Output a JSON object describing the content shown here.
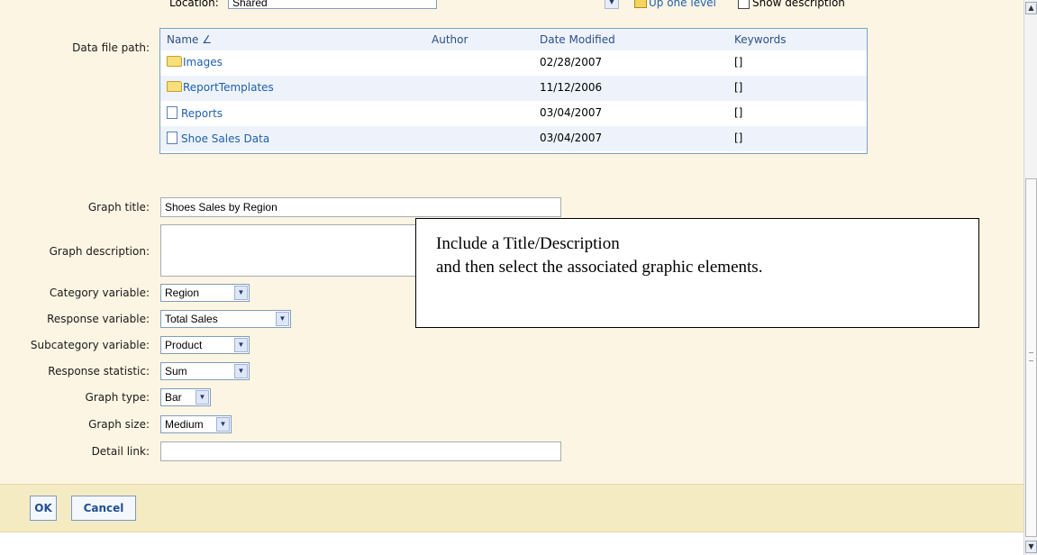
{
  "location": {
    "label": "Location:",
    "value": "Shared",
    "up_level": "Up one level",
    "show_description": "Show description"
  },
  "data_file_path_label": "Data file path:",
  "file_table": {
    "columns": {
      "name": "Name",
      "sort_indicator": "∠",
      "author": "Author",
      "date": "Date Modified",
      "keywords": "Keywords"
    },
    "rows": [
      {
        "name": "Images",
        "type": "folder",
        "date": "02/28/2007",
        "keywords": "[]"
      },
      {
        "name": "ReportTemplates",
        "type": "folder",
        "date": "11/12/2006",
        "keywords": "[]"
      },
      {
        "name": "Reports",
        "type": "document",
        "date": "03/04/2007",
        "keywords": "[]"
      },
      {
        "name": "Shoe Sales Data",
        "type": "document",
        "date": "03/04/2007",
        "keywords": "[]"
      }
    ]
  },
  "form": {
    "graph_title": {
      "label": "Graph title:",
      "value": "Shoes Sales by Region"
    },
    "graph_description": {
      "label": "Graph description:",
      "value": ""
    },
    "category_variable": {
      "label": "Category variable:",
      "value": "Region"
    },
    "response_variable": {
      "label": "Response variable:",
      "value": "Total Sales"
    },
    "subcategory_variable": {
      "label": "Subcategory variable:",
      "value": "Product"
    },
    "response_statistic": {
      "label": "Response statistic:",
      "value": "Sum"
    },
    "graph_type": {
      "label": "Graph type:",
      "value": "Bar"
    },
    "graph_size": {
      "label": "Graph size:",
      "value": "Medium"
    },
    "detail_link": {
      "label": "Detail link:",
      "value": ""
    }
  },
  "callout": {
    "line1": "Include a Title/Description",
    "line2": "and then select the associated graphic elements."
  },
  "buttons": {
    "ok": "OK",
    "cancel": "Cancel"
  },
  "icons": {
    "dropdown": "chevron-down-icon",
    "folder": "folder-icon",
    "document": "document-icon"
  },
  "colors": {
    "panel_bg": "#fcf5e3",
    "footer_bg": "#f5ebc3",
    "link": "#1f5fad",
    "table_header": "#eef3fb"
  }
}
